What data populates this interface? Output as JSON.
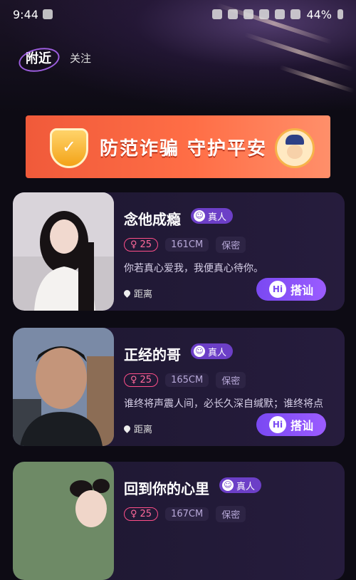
{
  "status": {
    "time": "9:44",
    "battery": "44%"
  },
  "nav": {
    "tabs": [
      {
        "label": "附近"
      },
      {
        "label": "关注"
      }
    ]
  },
  "banner": {
    "text": "防范诈骗 守护平安"
  },
  "cards": [
    {
      "name": "念他成瘾",
      "verified": "真人",
      "age": "25",
      "height": "161CM",
      "secret": "保密",
      "bio": "你若真心爱我，我便真心待你。",
      "distance": "距离",
      "greet_badge": "Hi",
      "greet_label": "搭讪"
    },
    {
      "name": "正经的哥",
      "verified": "真人",
      "age": "25",
      "height": "165CM",
      "secret": "保密",
      "bio": "谁终将声震人间，必长久深自缄默；谁终将点",
      "distance": "距离",
      "greet_badge": "Hi",
      "greet_label": "搭讪"
    },
    {
      "name": "回到你的心里",
      "verified": "真人",
      "age": "25",
      "height": "167CM",
      "secret": "保密"
    }
  ]
}
